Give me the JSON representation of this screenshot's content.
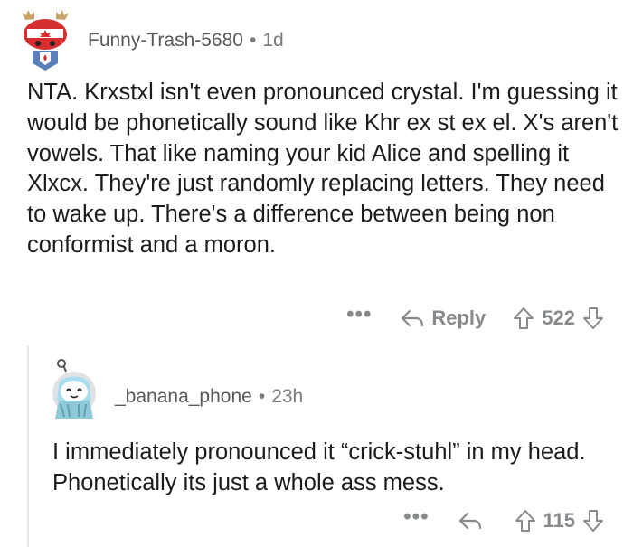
{
  "comments": [
    {
      "username": "Funny-Trash-5680",
      "age": "1d",
      "body": "NTA. Krxstxl isn't even pronounced crystal. I'm guessing it would be phonetically sound like Khr ex st ex el. X's aren't vowels. That like naming your kid Alice and spelling it Xlxcx. They're just randomly replacing letters. They need to wake up. There's a difference between being non conformist and a moron.",
      "more_label": "•••",
      "reply_label": "Reply",
      "score": "522"
    },
    {
      "username": "_banana_phone",
      "age": "23h",
      "body": "I immediately pronounced it “crick-stuhl” in my head. Phonetically its just a whole ass mess.",
      "more_label": "•••",
      "score": "115"
    }
  ],
  "separator": "•",
  "colors": {
    "meta": "#787c7e",
    "action": "#878a8c",
    "avatar_bg": "#a2d2ff"
  }
}
